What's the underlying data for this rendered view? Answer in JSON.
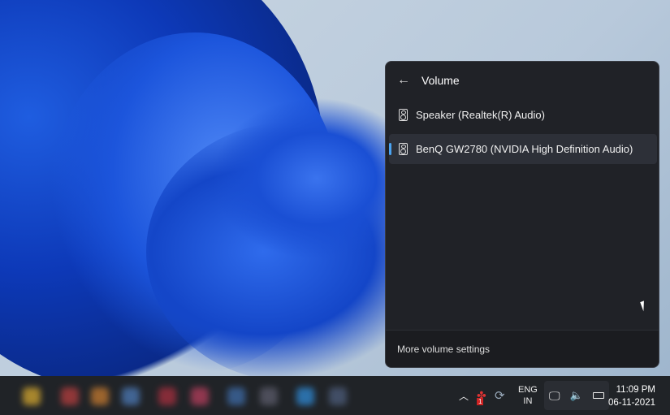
{
  "panel": {
    "title": "Volume",
    "devices": [
      {
        "label": "Speaker (Realtek(R) Audio)",
        "selected": false
      },
      {
        "label": "BenQ GW2780 (NVIDIA High Definition Audio)",
        "selected": true
      }
    ],
    "footer_link": "More volume settings"
  },
  "taskbar": {
    "language": "ENG",
    "region": "IN",
    "time": "11:09 PM",
    "date": "06-11-2021",
    "badge": "1"
  }
}
